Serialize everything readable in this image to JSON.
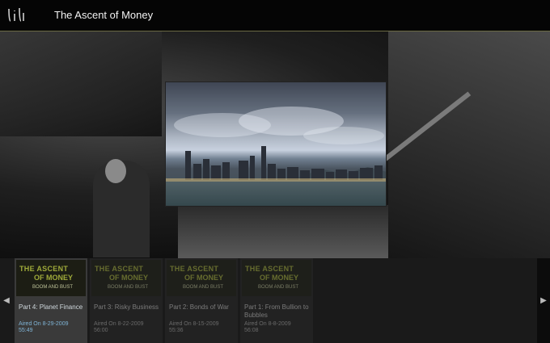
{
  "header": {
    "logo_icon": "lifetime-style-logo-icon",
    "title": "The Ascent of Money"
  },
  "player": {
    "background": "trading-floor-scene",
    "video_frame": "city-skyline-over-water"
  },
  "carousel": {
    "prev_icon": "◀",
    "next_icon": "▶",
    "episodes": [
      {
        "thumb_line1": "THE ASCENT",
        "thumb_line2": "OF MONEY",
        "thumb_line3": "BOOM AND BUST",
        "title": "Part 4: Planet Finance",
        "aired": "Aired On 8-29-2009",
        "duration": "55:49",
        "active": true
      },
      {
        "thumb_line1": "THE ASCENT",
        "thumb_line2": "OF MONEY",
        "thumb_line3": "BOOM AND BUST",
        "title": "Part 3: Risky Business",
        "aired": "Aired On 8-22-2009",
        "duration": "56:00",
        "active": false
      },
      {
        "thumb_line1": "THE ASCENT",
        "thumb_line2": "OF MONEY",
        "thumb_line3": "BOOM AND BUST",
        "title": "Part 2: Bonds of War",
        "aired": "Aired On 8-15-2009",
        "duration": "55:36",
        "active": false
      },
      {
        "thumb_line1": "THE ASCENT",
        "thumb_line2": "OF MONEY",
        "thumb_line3": "BOOM AND BUST",
        "title": "Part 1: From Bullion to Bubbles",
        "aired": "Aired On 8-8-2009",
        "duration": "56:08",
        "active": false
      }
    ]
  },
  "colors": {
    "accent_blue": "#7fb3d5",
    "thumb_text": "#9faa3a",
    "header_rule": "#6b6a44"
  }
}
